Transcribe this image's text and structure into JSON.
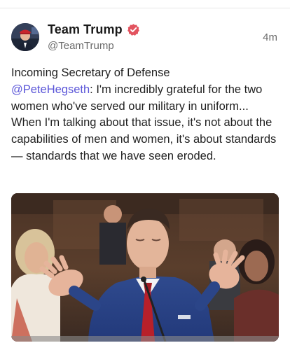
{
  "post": {
    "author_name": "Team Trump",
    "handle": "@TeamTrump",
    "time_ago": "4m",
    "text_before": "Incoming Secretary of Defense\n",
    "mention": "@PeteHegseth",
    "text_after": ": I'm incredibly grateful for the two women who've served our military in uniform... When I'm talking about that issue, it's not about the capabilities of men and women, it's about standards — standards that we have seen eroded."
  },
  "icons": {
    "verified": "verified-badge-icon",
    "verified_color": "#e2535f",
    "mention_color": "#5a55d8"
  }
}
